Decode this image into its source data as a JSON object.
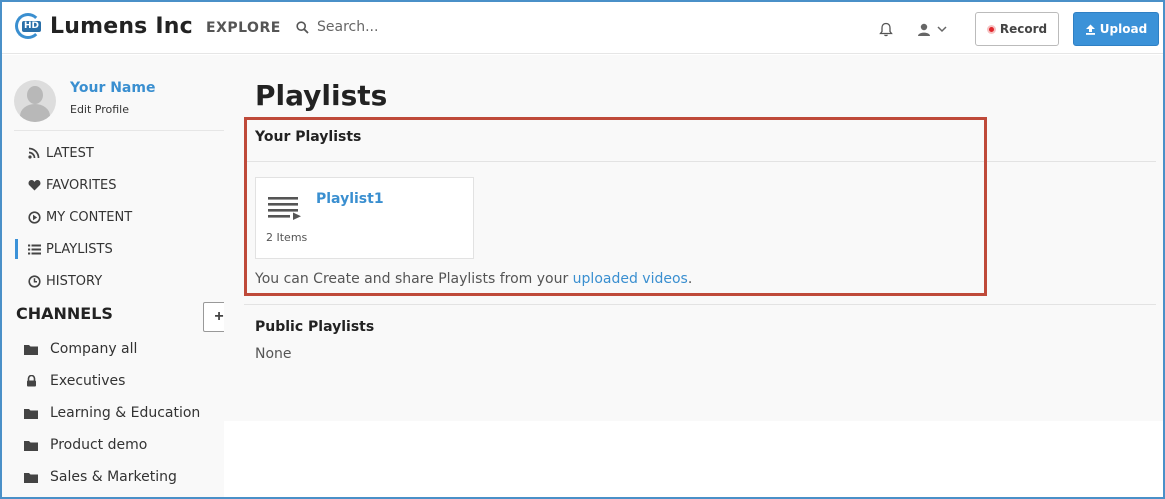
{
  "header": {
    "logo_badge": "HD",
    "logo_text": "Lumens Inc",
    "explore_label": "EXPLORE",
    "search_placeholder": "Search...",
    "record_label": "Record",
    "upload_label": "Upload"
  },
  "sidebar": {
    "profile": {
      "name": "Your Name",
      "edit_label": "Edit Profile"
    },
    "menu": [
      {
        "label": "LATEST",
        "icon": "rss-icon"
      },
      {
        "label": "FAVORITES",
        "icon": "heart-icon"
      },
      {
        "label": "MY CONTENT",
        "icon": "play-circle-icon"
      },
      {
        "label": "PLAYLISTS",
        "icon": "list-icon",
        "active": true
      },
      {
        "label": "HISTORY",
        "icon": "clock-icon"
      }
    ],
    "channels_title": "CHANNELS",
    "add_channel_label": "+",
    "channels": [
      {
        "label": "Company all",
        "icon": "folder-icon"
      },
      {
        "label": "Executives",
        "icon": "lock-icon"
      },
      {
        "label": "Learning & Education",
        "icon": "folder-icon"
      },
      {
        "label": "Product demo",
        "icon": "folder-icon"
      },
      {
        "label": "Sales & Marketing",
        "icon": "folder-icon"
      }
    ]
  },
  "main": {
    "page_title": "Playlists",
    "your_playlists_title": "Your Playlists",
    "playlists": [
      {
        "title": "Playlist1",
        "count": "2 Items"
      }
    ],
    "hint_text": "You can Create and share Playlists from your ",
    "hint_link": "uploaded videos",
    "hint_end": ".",
    "public_playlists_title": "Public Playlists",
    "public_none": "None"
  },
  "colors": {
    "accent": "#3b92d8",
    "highlight_box": "#bf4a3a",
    "record_dot": "#e0252b"
  }
}
